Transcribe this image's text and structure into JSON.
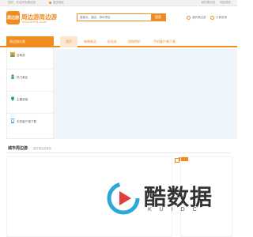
{
  "topbar": {
    "welcome": "您好，欢迎来到周边游",
    "location": "重庆地区",
    "links": [
      "我的周边游",
      "网站导航"
    ]
  },
  "header": {
    "logo_badge": "周边游",
    "site_title": "周边游周边游",
    "site_subtitle": "TAOCHUPA.COM",
    "search_placeholder": "搜景点、酒店、游玩项目",
    "search_button": "搜索",
    "action_orders": "我的周边游",
    "action_cart": "订单查询"
  },
  "nav": {
    "category_head": "周边游分类",
    "items": [
      {
        "label": "首页"
      },
      {
        "label": "每周新品"
      },
      {
        "label": "好去处"
      },
      {
        "label": "团购特价"
      },
      {
        "label": "手机客户端下载"
      }
    ]
  },
  "sidebar": {
    "items": [
      {
        "label": "自助游",
        "icon": "landscape-icon"
      },
      {
        "label": "热门景区",
        "icon": "person-icon"
      },
      {
        "label": "主题游客",
        "icon": "location-icon"
      },
      {
        "label": "手机客户端下载",
        "icon": "phone-icon"
      }
    ]
  },
  "section": {
    "title": "城市周边游",
    "subtitle": "重庆周边游推荐"
  },
  "watermark": {
    "text": "酷数据",
    "sub": "KUIDC"
  },
  "colors": {
    "accent": "#f08c1e",
    "banner": "#eef6fb"
  }
}
